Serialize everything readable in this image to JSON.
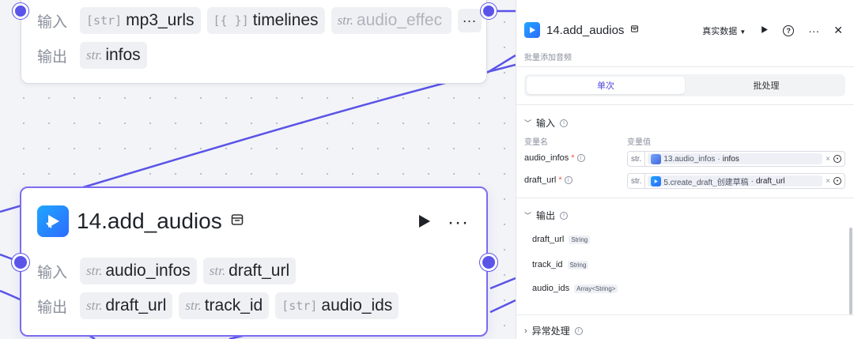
{
  "node_prev": {
    "input_label": "输入",
    "output_label": "输出",
    "inputs": [
      {
        "type": "[str]",
        "name": "mp3_urls"
      },
      {
        "type": "[{ }]",
        "name": "timelines"
      },
      {
        "type": "str.",
        "name": "audio_effec"
      }
    ],
    "more": "···",
    "outputs": [
      {
        "type": "str.",
        "name": "infos"
      }
    ]
  },
  "node_current": {
    "title": "14.add_audios",
    "input_label": "输入",
    "output_label": "输出",
    "inputs": [
      {
        "type": "str.",
        "name": "audio_infos"
      },
      {
        "type": "str.",
        "name": "draft_url"
      }
    ],
    "outputs": [
      {
        "type": "str.",
        "name": "draft_url"
      },
      {
        "type": "str.",
        "name": "track_id"
      },
      {
        "type": "[str]",
        "name": "audio_ids"
      }
    ]
  },
  "panel": {
    "title": "14.add_audios",
    "description": "批量添加音频",
    "data_mode": "真实数据",
    "tabs": [
      "单次",
      "批处理"
    ],
    "input_section": "输入",
    "col_name": "变量名",
    "col_value": "变量值",
    "inputs": [
      {
        "name": "audio_infos",
        "type": "str.",
        "ref_node": "13.audio_infos",
        "ref_field": "infos"
      },
      {
        "name": "draft_url",
        "type": "str.",
        "ref_node": "5.create_draft_创建草稿",
        "ref_field": "draft_url"
      }
    ],
    "output_section": "输出",
    "outputs": [
      {
        "name": "draft_url",
        "type": "String"
      },
      {
        "name": "track_id",
        "type": "String"
      },
      {
        "name": "audio_ids",
        "type": "Array<String>"
      }
    ],
    "exception_section": "异常处理"
  },
  "colors": {
    "accent": "#5a54e8",
    "node_border": "#7b6cf0",
    "app_icon": "#1fa7ff"
  }
}
